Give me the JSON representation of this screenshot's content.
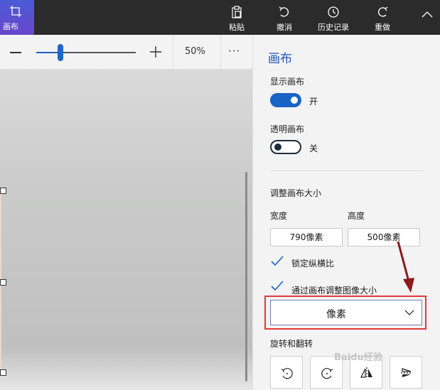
{
  "toolbar": {
    "canvas_label": "画布",
    "paste_label": "粘贴",
    "undo_label": "撤消",
    "history_label": "历史记录",
    "redo_label": "重做"
  },
  "zoom": {
    "percent_label": "50%",
    "slider_fraction": 0.24,
    "more_label": "···"
  },
  "panel": {
    "title": "画布",
    "show_canvas_label": "显示画布",
    "show_canvas_state": "开",
    "transparent_canvas_label": "透明画布",
    "transparent_canvas_state": "关",
    "resize_heading": "调整画布大小",
    "width_label": "宽度",
    "height_label": "高度",
    "width_value": "790像素",
    "height_value": "500像素",
    "lock_aspect_label": "锁定纵横比",
    "resize_image_label": "通过画布调整图像大小",
    "unit_value": "像素",
    "rotate_flip_heading": "旋转和翻转"
  },
  "colors": {
    "accent": "#1a63c6",
    "highlight": "#e03a3a",
    "arrow": "#8b1a1a",
    "title": "#1f56c4"
  },
  "watermark": {
    "text": "Baidu经验"
  }
}
